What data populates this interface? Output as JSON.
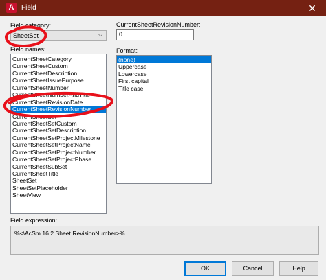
{
  "window": {
    "title": "Field",
    "app_icon_letter": "A"
  },
  "field_category": {
    "label": "Field category:",
    "value": "SheetSet"
  },
  "field_names": {
    "label": "Field names:",
    "items": [
      "CurrentSheetCategory",
      "CurrentSheetCustom",
      "CurrentSheetDescription",
      "CurrentSheetIssuePurpose",
      "CurrentSheetNumber",
      "CurrentSheetNumberAndTitle",
      "CurrentSheetRevisionDate",
      "CurrentSheetRevisionNumber",
      "CurrentSheetSet",
      "CurrentSheetSetCustom",
      "CurrentSheetSetDescription",
      "CurrentSheetSetProjectMilestone",
      "CurrentSheetSetProjectName",
      "CurrentSheetSetProjectNumber",
      "CurrentSheetSetProjectPhase",
      "CurrentSheetSubSet",
      "CurrentSheetTitle",
      "SheetSet",
      "SheetSetPlaceholder",
      "SheetView"
    ],
    "selected": "CurrentSheetRevisionNumber"
  },
  "field_value": {
    "label": "CurrentSheetRevisionNumber:",
    "value": "0"
  },
  "format": {
    "label": "Format:",
    "items": [
      "(none)",
      "Uppercase",
      "Lowercase",
      "First capital",
      "Title case"
    ],
    "selected": "(none)"
  },
  "field_expression": {
    "label": "Field expression:",
    "value": "%<\\AcSm.16.2 Sheet.RevisionNumber>%"
  },
  "buttons": {
    "ok": "OK",
    "cancel": "Cancel",
    "help": "Help"
  },
  "colors": {
    "titlebar": "#752112",
    "selection": "#0078d7",
    "annotation": "#e8101a"
  },
  "icons": {
    "close": "close-icon",
    "dropdown": "chevron-down-icon",
    "app": "autocad-icon"
  }
}
